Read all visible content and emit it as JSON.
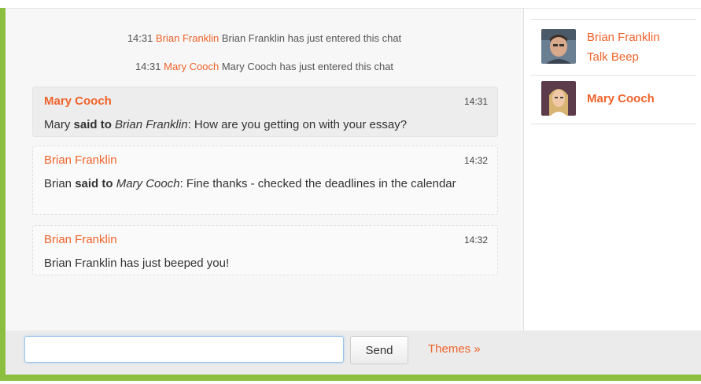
{
  "system_messages": [
    {
      "time": "14:31",
      "name": "Brian Franklin",
      "text": "Brian Franklin has just entered this chat"
    },
    {
      "time": "14:31",
      "name": "Mary Cooch",
      "text": "Mary Cooch has just entered this chat"
    }
  ],
  "messages": [
    {
      "author": "Mary Cooch",
      "time": "14:31",
      "sender": "Mary",
      "said": "said to",
      "recipient": "Brian Franklin",
      "text": ": How are you getting on with your essay?"
    },
    {
      "author": "Brian Franklin",
      "time": "14:32",
      "sender": "Brian",
      "said": "said to",
      "recipient": "Mary Cooch",
      "text": ": Fine thanks - checked the deadlines in the calendar"
    },
    {
      "author": "Brian Franklin",
      "time": "14:32",
      "text": "Brian Franklin has just beeped you!"
    }
  ],
  "users": [
    {
      "name": "Brian Franklin",
      "action": "Talk Beep"
    },
    {
      "name": "Mary Cooch"
    }
  ],
  "input": {
    "value": "",
    "placeholder": ""
  },
  "send_label": "Send",
  "themes_label": "Themes »",
  "colors": {
    "accent": "#f0632a",
    "border_green": "#8cbf3f"
  }
}
